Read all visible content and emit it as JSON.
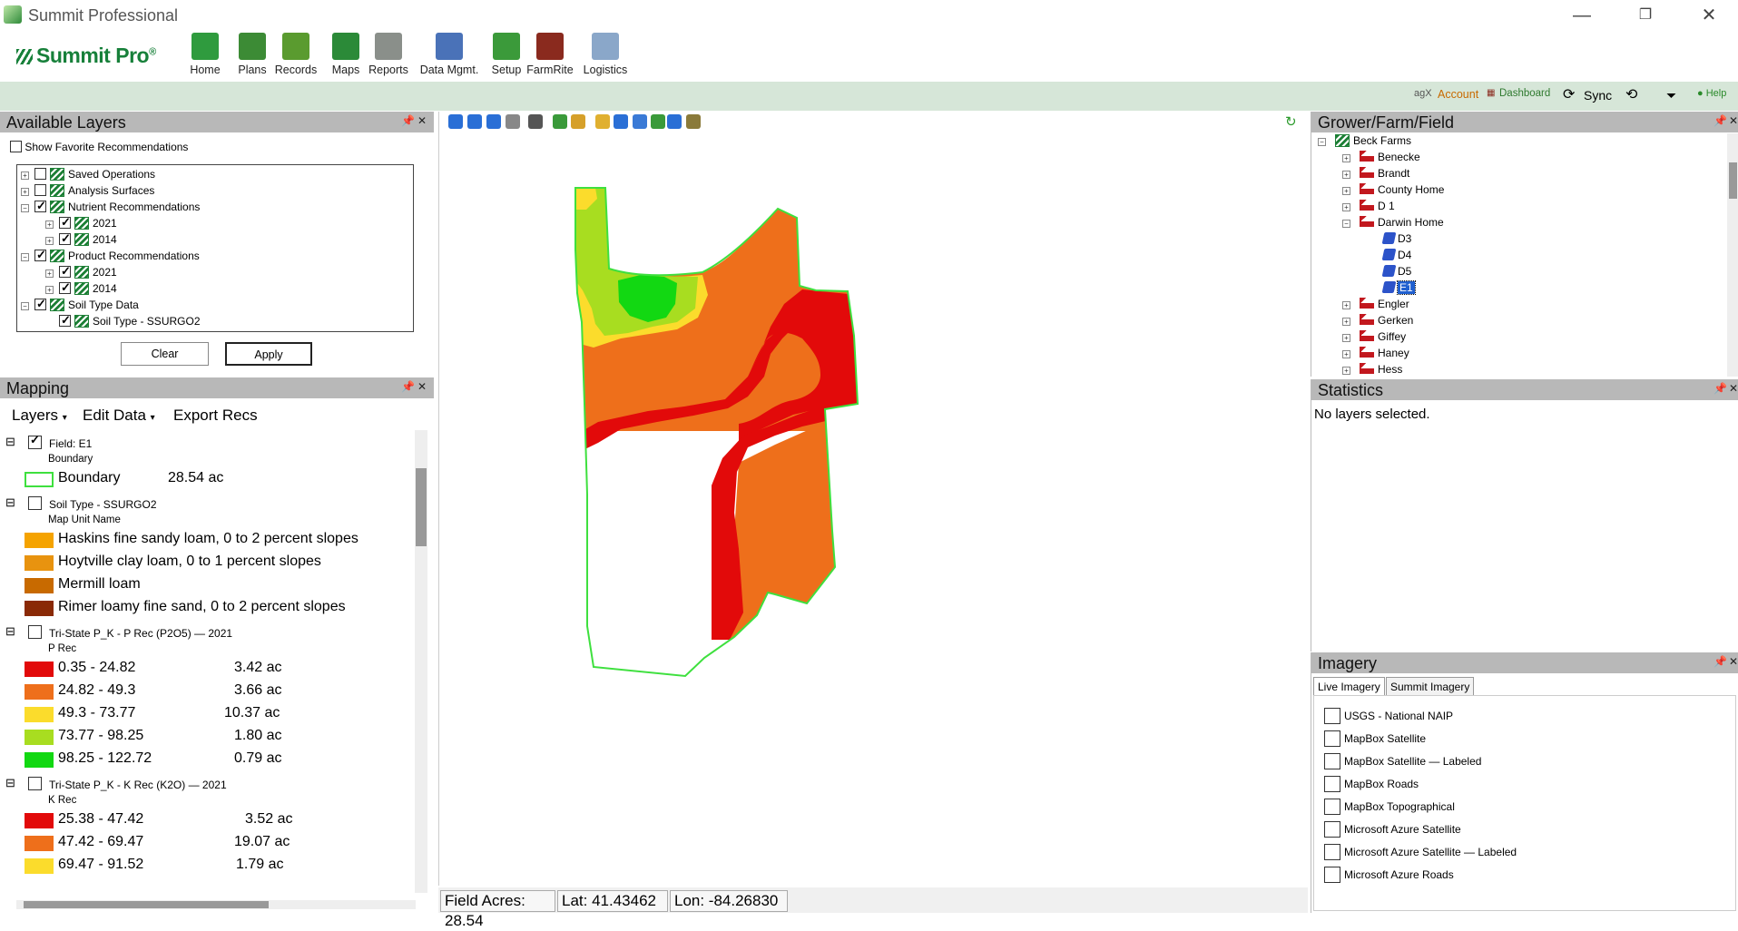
{
  "app": {
    "title": "Summit Professional",
    "logo_text": "Summit Pro"
  },
  "window_controls": {
    "minimize": "—",
    "restore": "❐",
    "close": "✕"
  },
  "ribbon": [
    {
      "label": "Home",
      "icon": "home-icon",
      "color": "#2f9b3e"
    },
    {
      "label": "Plans",
      "icon": "plans-icon",
      "color": "#3c8b35"
    },
    {
      "label": "Records",
      "icon": "records-icon",
      "color": "#5a9b2f"
    },
    {
      "label": "Maps",
      "icon": "maps-icon",
      "color": "#2b8a38"
    },
    {
      "label": "Reports",
      "icon": "reports-icon",
      "color": "#8a8f8a"
    },
    {
      "label": "Data Mgmt.",
      "icon": "data-mgmt-icon",
      "color": "#4a72b8"
    },
    {
      "label": "Setup",
      "icon": "setup-icon",
      "color": "#3b9a3a"
    },
    {
      "label": "FarmRite",
      "icon": "farmrite-icon",
      "color": "#8a2a1e"
    },
    {
      "label": "Logistics",
      "icon": "logistics-icon",
      "color": "#8aa7c9"
    }
  ],
  "toolbar_right": {
    "agx": "agX",
    "account": "Account",
    "dashboard": "Dashboard",
    "sync": "Sync",
    "help": "Help"
  },
  "available_layers": {
    "title": "Available Layers",
    "show_favorites": "Show Favorite Recommendations",
    "tree": [
      {
        "label": "Saved Operations",
        "checked": false,
        "expander": "+"
      },
      {
        "label": "Analysis Surfaces",
        "checked": false,
        "expander": "+"
      },
      {
        "label": "Nutrient Recommendations",
        "checked": true,
        "expander": "−"
      },
      {
        "label": "2021",
        "checked": true,
        "expander": "+"
      },
      {
        "label": "2014",
        "checked": true,
        "expander": "+"
      },
      {
        "label": "Product Recommendations",
        "checked": true,
        "expander": "−"
      },
      {
        "label": "2021",
        "checked": true,
        "expander": "+"
      },
      {
        "label": "2014",
        "checked": true,
        "expander": "+"
      },
      {
        "label": "Soil Type Data",
        "checked": true,
        "expander": "−"
      },
      {
        "label": "Soil Type - SSURGO2",
        "checked": true,
        "expander": ""
      }
    ],
    "clear": "Clear",
    "apply": "Apply"
  },
  "mapping": {
    "title": "Mapping",
    "menu": {
      "layers": "Layers",
      "edit_data": "Edit Data",
      "export_recs": "Export Recs"
    },
    "field_layer": {
      "title": "Field: E1",
      "checked": true,
      "sub": "Boundary",
      "item": "Boundary",
      "acres": "28.54 ac"
    },
    "soil_layer": {
      "title": "Soil Type - SSURGO2",
      "checked": false,
      "sub": "Map Unit Name",
      "items": [
        {
          "label": "Haskins fine sandy loam, 0 to 2 percent slopes",
          "color": "#f5a300"
        },
        {
          "label": "Hoytville clay loam, 0 to 1 percent slopes",
          "color": "#e8930f"
        },
        {
          "label": "Mermill loam",
          "color": "#c86a00"
        },
        {
          "label": "Rimer loamy fine sand, 0 to 2 percent slopes",
          "color": "#8a2a06"
        }
      ]
    },
    "p_layer": {
      "title": "Tri-State P_K - P Rec (P2O5) — 2021",
      "checked": false,
      "sub": "P Rec",
      "items": [
        {
          "label": "0.35 - 24.82",
          "acres": "3.42 ac",
          "color": "#e20a0a"
        },
        {
          "label": "24.82 - 49.3",
          "acres": "3.66 ac",
          "color": "#ee6f1b"
        },
        {
          "label": "49.3 - 73.77",
          "acres": "10.37 ac",
          "color": "#fbdc2c"
        },
        {
          "label": "73.77 - 98.25",
          "acres": "1.80 ac",
          "color": "#a8dd20"
        },
        {
          "label": "98.25 - 122.72",
          "acres": "0.79 ac",
          "color": "#12d812"
        }
      ]
    },
    "k_layer": {
      "title": "Tri-State P_K - K Rec (K2O) — 2021",
      "checked": false,
      "sub": "K Rec",
      "items": [
        {
          "label": "25.38 - 47.42",
          "acres": "3.52 ac",
          "color": "#e20a0a"
        },
        {
          "label": "47.42 - 69.47",
          "acres": "19.07 ac",
          "color": "#ee6f1b"
        },
        {
          "label": "69.47 - 91.52",
          "acres": "1.79 ac",
          "color": "#fbdc2c"
        }
      ]
    }
  },
  "status": {
    "acres": "Field Acres: 28.54",
    "lat": "Lat: 41.43462",
    "lon": "Lon: -84.26830"
  },
  "gff": {
    "title": "Grower/Farm/Field",
    "grower": "Beck Farms",
    "farms_before": [
      "Benecke",
      "Brandt",
      "County Home",
      "D 1"
    ],
    "open_farm": "Darwin Home",
    "fields": [
      "D3",
      "D4",
      "D5",
      "E1"
    ],
    "selected_field": "E1",
    "farms_after": [
      "Engler",
      "Gerken",
      "Giffey",
      "Haney",
      "Hess"
    ]
  },
  "statistics": {
    "title": "Statistics",
    "message": "No layers selected."
  },
  "imagery": {
    "title": "Imagery",
    "tabs": [
      "Live Imagery",
      "Summit Imagery"
    ],
    "sources": [
      "USGS - National NAIP",
      "MapBox Satellite",
      "MapBox Satellite — Labeled",
      "MapBox Roads",
      "MapBox Topographical",
      "Microsoft Azure Satellite",
      "Microsoft Azure Satellite — Labeled",
      "Microsoft Azure Roads"
    ]
  },
  "colors": {
    "boundary": "#3ee03e",
    "red": "#e20a0a",
    "orange": "#ee6f1b",
    "yellow": "#fbdc2c",
    "lime": "#a8dd20",
    "green": "#12d812",
    "panel_head": "#b8b8b8",
    "green_bar": "#d6e6d8"
  }
}
